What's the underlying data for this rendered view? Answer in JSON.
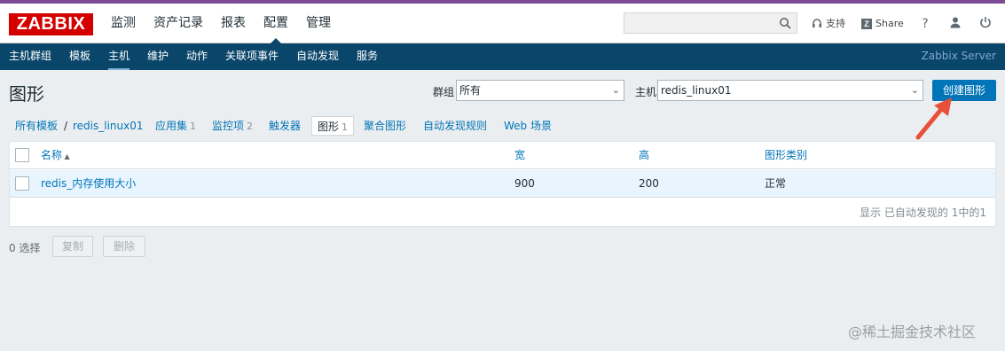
{
  "header": {
    "logo": "ZABBIX",
    "menu": [
      "监测",
      "资产记录",
      "报表",
      "配置",
      "管理"
    ],
    "search_placeholder": "",
    "support": "支持",
    "share": "Share",
    "share_icon_letter": "Z",
    "help": "?",
    "icons": [
      "search-icon",
      "headset-icon",
      "zshare-icon",
      "help-icon",
      "user-icon",
      "power-icon"
    ]
  },
  "subnav": {
    "items": [
      "主机群组",
      "模板",
      "主机",
      "维护",
      "动作",
      "关联项事件",
      "自动发现",
      "服务"
    ],
    "server": "Zabbix Server"
  },
  "page": {
    "title": "图形",
    "filter_group_label": "群组",
    "filter_group_value": "所有",
    "filter_host_label": "主机",
    "filter_host_value": "redis_linux01",
    "create_button": "创建图形"
  },
  "tabs": [
    {
      "label": "所有模板",
      "count": ""
    },
    {
      "label": "redis_linux01",
      "count": ""
    },
    {
      "label": "应用集",
      "count": "1"
    },
    {
      "label": "监控项",
      "count": "2"
    },
    {
      "label": "触发器",
      "count": ""
    },
    {
      "label": "图形",
      "count": "1"
    },
    {
      "label": "聚合图形",
      "count": ""
    },
    {
      "label": "自动发现规则",
      "count": ""
    },
    {
      "label": "Web 场景",
      "count": ""
    }
  ],
  "breadcrumb_separator": "/",
  "table": {
    "columns": [
      "名称",
      "宽",
      "高",
      "图形类别"
    ],
    "rows": [
      {
        "name": "redis_内存使用大小",
        "width": "900",
        "height": "200",
        "type": "正常"
      }
    ],
    "footer": "显示 已自动发现的 1中的1"
  },
  "actions": {
    "selected": "0 选择",
    "copy": "复制",
    "delete": "删除"
  },
  "watermark": "@稀土掘金技术社区",
  "colors": {
    "accent": "#0275b8",
    "subnav": "#0a466a",
    "logo": "#d40000",
    "arrow": "#e8503a"
  }
}
